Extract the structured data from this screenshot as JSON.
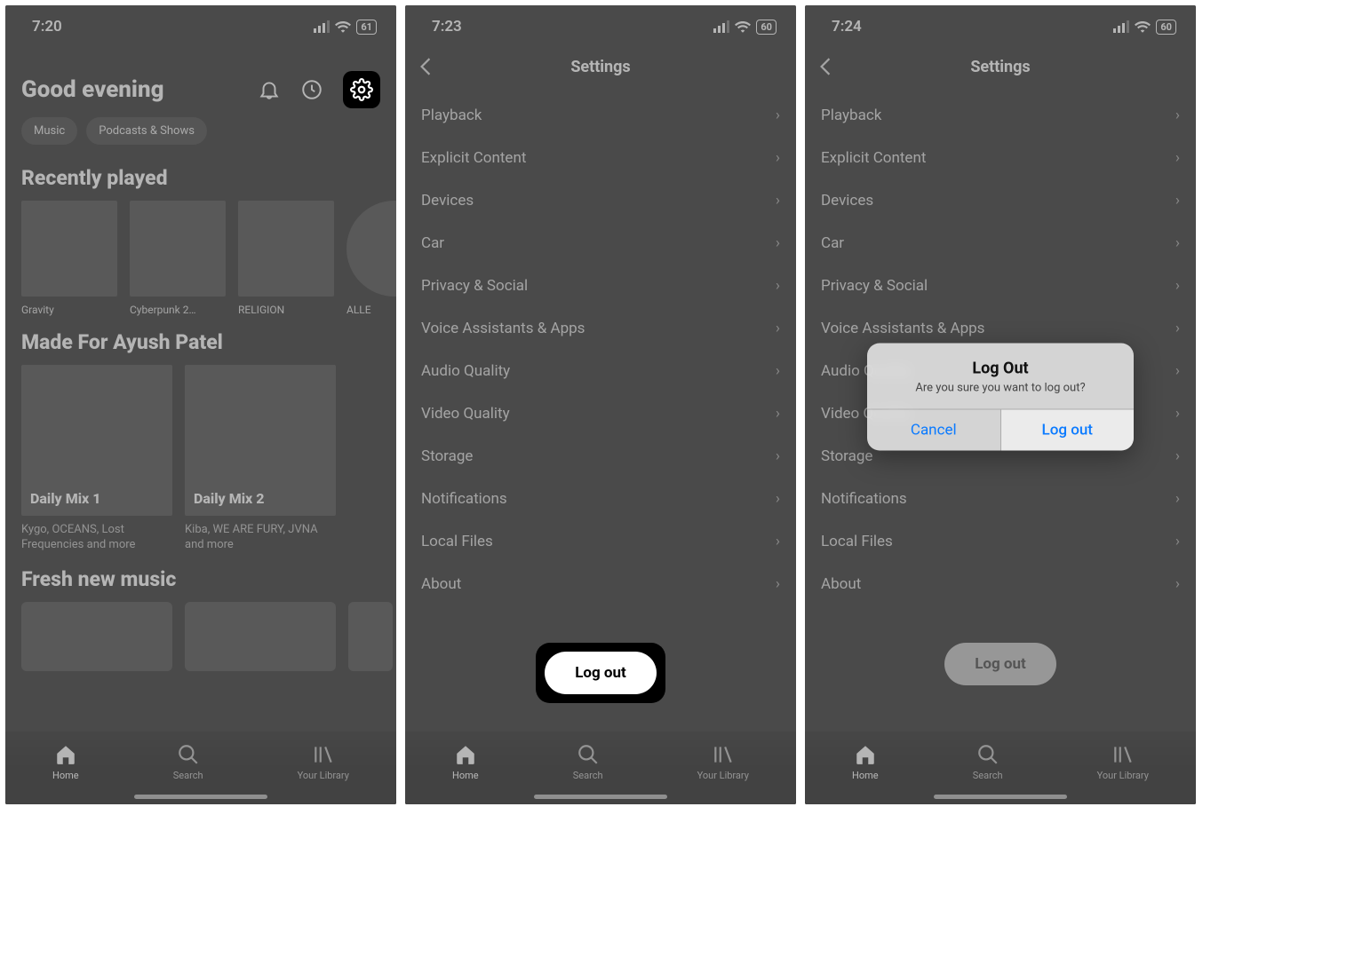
{
  "status": {
    "times": [
      "7:20",
      "7:23",
      "7:24"
    ],
    "battery": [
      "61",
      "60",
      "60"
    ]
  },
  "home": {
    "greeting": "Good evening",
    "chips": [
      "Music",
      "Podcasts & Shows"
    ],
    "recently_title": "Recently played",
    "recently": [
      {
        "label": "Gravity"
      },
      {
        "label": "Cyberpunk 2…"
      },
      {
        "label": "RELIGION"
      },
      {
        "label": "ALLE"
      }
    ],
    "madefor_title": "Made For Ayush Patel",
    "madefor": [
      {
        "title": "Daily Mix 1",
        "sub": "Kygo, OCEANS, Lost Frequencies and more"
      },
      {
        "title": "Daily Mix 2",
        "sub": "Kiba, WE ARE FURY, JVNA and more"
      }
    ],
    "fresh_title": "Fresh new music"
  },
  "settings": {
    "title": "Settings",
    "items": [
      "Playback",
      "Explicit Content",
      "Devices",
      "Car",
      "Privacy & Social",
      "Voice Assistants & Apps",
      "Audio Quality",
      "Video Quality",
      "Storage",
      "Notifications",
      "Local Files",
      "About"
    ],
    "logout": "Log out"
  },
  "alert": {
    "title": "Log Out",
    "message": "Are you sure you want to log out?",
    "cancel": "Cancel",
    "confirm": "Log out"
  },
  "nav": {
    "home": "Home",
    "search": "Search",
    "library": "Your Library"
  }
}
